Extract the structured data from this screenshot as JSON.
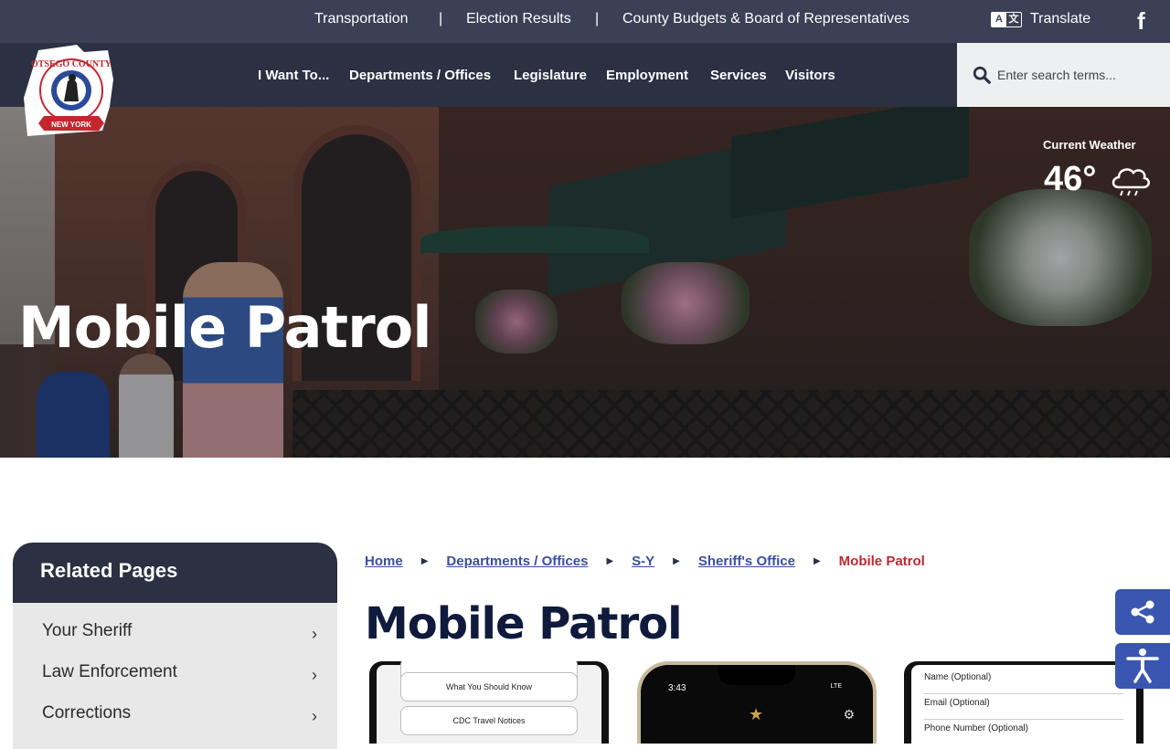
{
  "topbar": {
    "links": [
      "Transportation",
      "Election Results",
      "County Budgets & Board of Representatives"
    ],
    "separator": "|",
    "translate_label": "Translate",
    "facebook_glyph": "f"
  },
  "logo": {
    "county": "OTSEGO COUNTY",
    "state": "NEW YORK"
  },
  "nav": {
    "items": [
      "I Want To...",
      "Departments / Offices",
      "Legislature",
      "Employment",
      "Services",
      "Visitors"
    ]
  },
  "search": {
    "placeholder": "Enter search terms...",
    "value": ""
  },
  "hero": {
    "title": "Mobile Patrol"
  },
  "weather": {
    "label": "Current Weather",
    "temperature": "46°",
    "icon": "rain-cloud-icon"
  },
  "sidebar": {
    "title": "Related Pages",
    "items": [
      "Your Sheriff",
      "Law Enforcement",
      "Corrections"
    ]
  },
  "breadcrumb": {
    "items": [
      "Home",
      "Departments / Offices",
      "S-Y",
      "Sheriff's Office"
    ],
    "current": "Mobile Patrol"
  },
  "page": {
    "title": "Mobile Patrol"
  },
  "phones": {
    "left_buttons": [
      "What You Should Know",
      "CDC Travel Notices"
    ],
    "center_time": "3:43",
    "center_status": "LTE",
    "right_fields": [
      "Name (Optional)",
      "Email (Optional)",
      "Phone Number (Optional)"
    ]
  },
  "colors": {
    "topbar": "#3a4055",
    "navbar": "#2b3042",
    "link": "#3b4fa0",
    "current": "#c4262e",
    "title": "#0f1a3c",
    "float_button": "#3b56b0"
  }
}
